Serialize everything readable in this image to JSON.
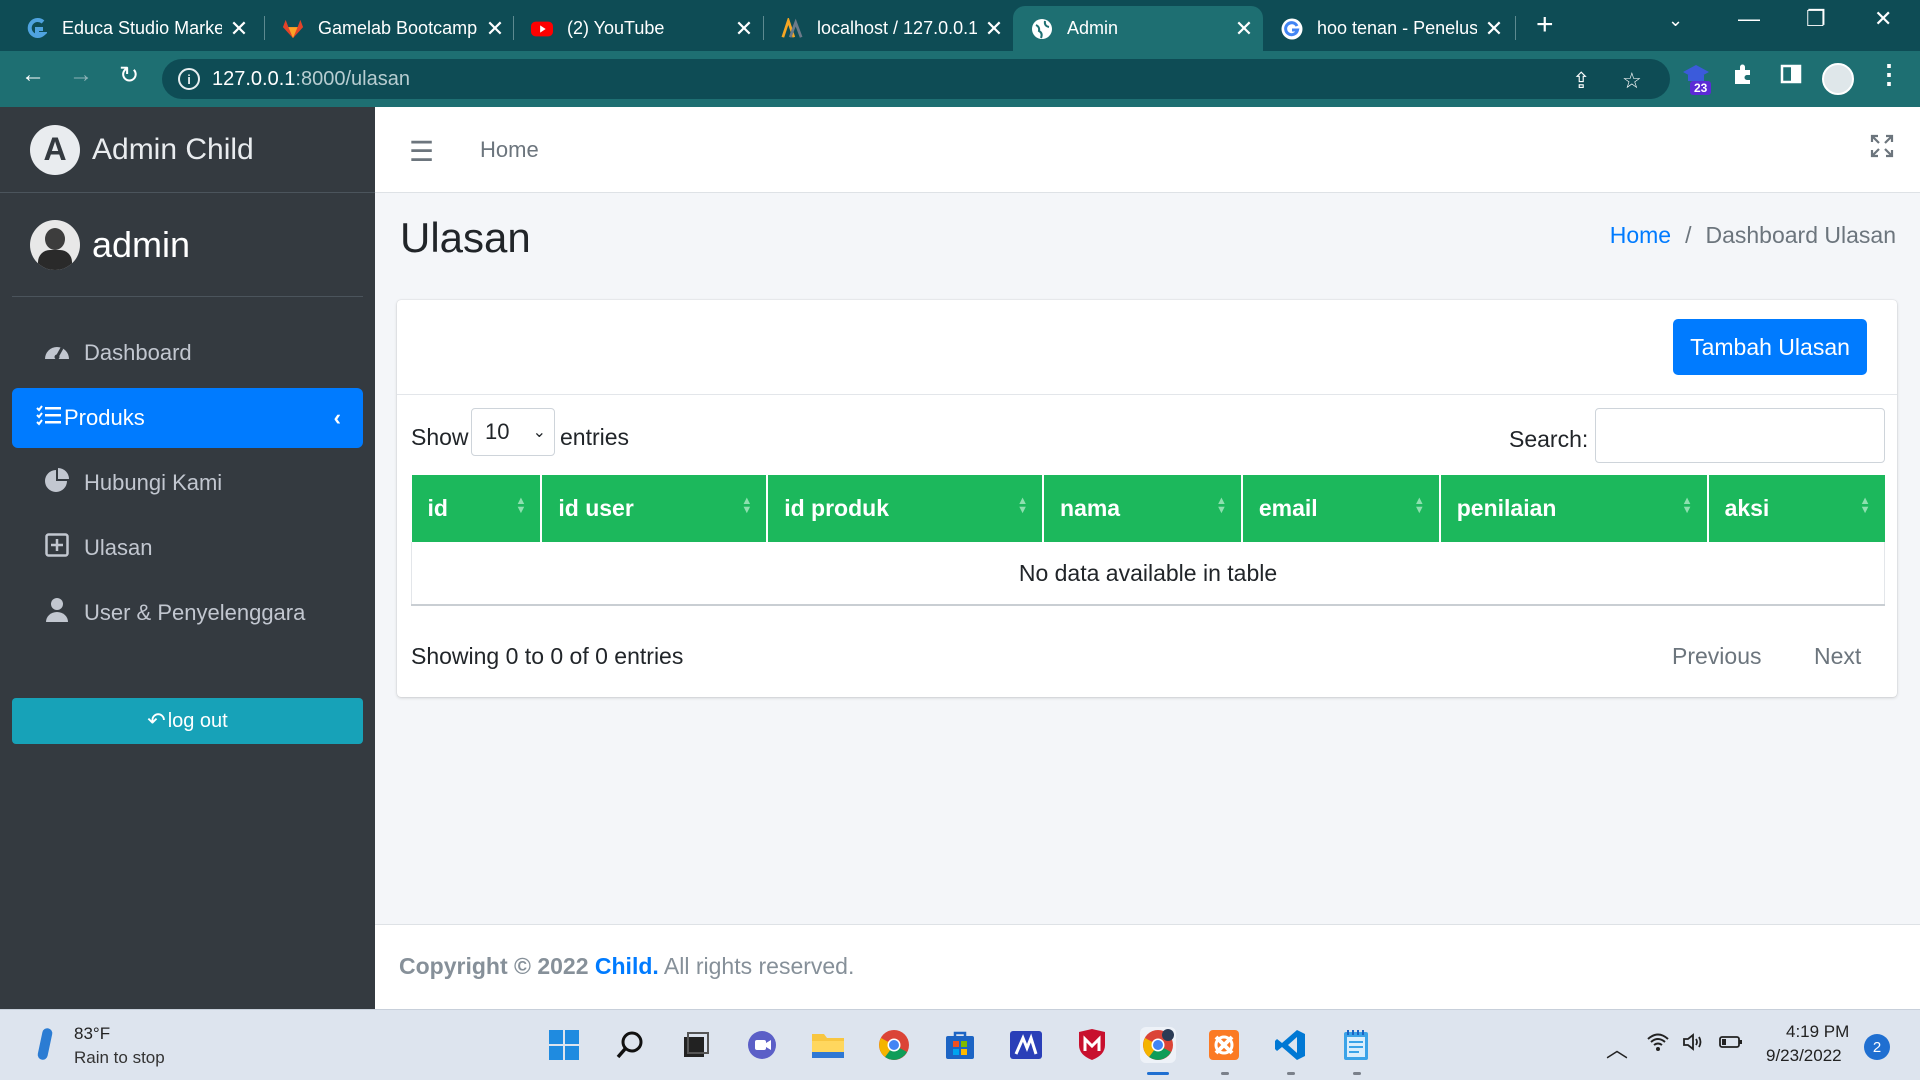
{
  "browser": {
    "tabs": [
      {
        "title": "Educa Studio Marketplace",
        "icon": "educa-favicon"
      },
      {
        "title": "Gamelab Bootcamp",
        "icon": "gitlab-favicon"
      },
      {
        "title": "(2) YouTube",
        "icon": "youtube-favicon"
      },
      {
        "title": "localhost / 127.0.0.1",
        "icon": "phpmyadmin-favicon"
      },
      {
        "title": "Admin",
        "icon": "globe-favicon"
      },
      {
        "title": "hoo tenan - Penelusuran",
        "icon": "google-favicon"
      }
    ],
    "close_glyph": "✕",
    "url_host": "127.0.0.1",
    "url_path": ":8000/ulasan",
    "extension_badge": "23"
  },
  "sidebar": {
    "brand": "Admin Child",
    "brand_logo_letter": "A",
    "user_name": "admin",
    "items": [
      {
        "label": "Dashboard",
        "icon": "tachometer-icon",
        "active": false
      },
      {
        "label": "Produks",
        "icon": "list-icon",
        "active": true
      },
      {
        "label": "Hubungi Kami",
        "icon": "pie-chart-icon",
        "active": false
      },
      {
        "label": "Ulasan",
        "icon": "plus-square-icon",
        "active": false
      },
      {
        "label": "User & Penyelenggara",
        "icon": "user-icon",
        "active": false
      }
    ],
    "logout_label": "log out"
  },
  "topnav": {
    "home_label": "Home"
  },
  "page": {
    "title": "Ulasan",
    "breadcrumb_home": "Home",
    "breadcrumb_sep": "/",
    "breadcrumb_current": "Dashboard Ulasan"
  },
  "table": {
    "add_button": "Tambah Ulasan",
    "show_label": "Show",
    "entries_label": "entries",
    "page_length": "10",
    "search_label": "Search:",
    "search_value": "",
    "columns": [
      "id",
      "id user",
      "id produk",
      "nama",
      "email",
      "penilaian",
      "aksi"
    ],
    "empty_message": "No data available in table",
    "info": "Showing 0 to 0 of 0 entries",
    "previous": "Previous",
    "next": "Next",
    "header_color": "#1cb85c"
  },
  "footer": {
    "copyright": "Copyright © 2022",
    "brand": "Child.",
    "rights": "All rights reserved."
  },
  "taskbar": {
    "temperature": "83°F",
    "weather": "Rain to stop",
    "time": "4:19 PM",
    "date": "9/23/2022",
    "notifications": "2"
  },
  "colors": {
    "accent": "#007bff",
    "sidebar_bg": "#343a40",
    "chrome_bg": "#0e4c55",
    "logout": "#17a2b8"
  }
}
